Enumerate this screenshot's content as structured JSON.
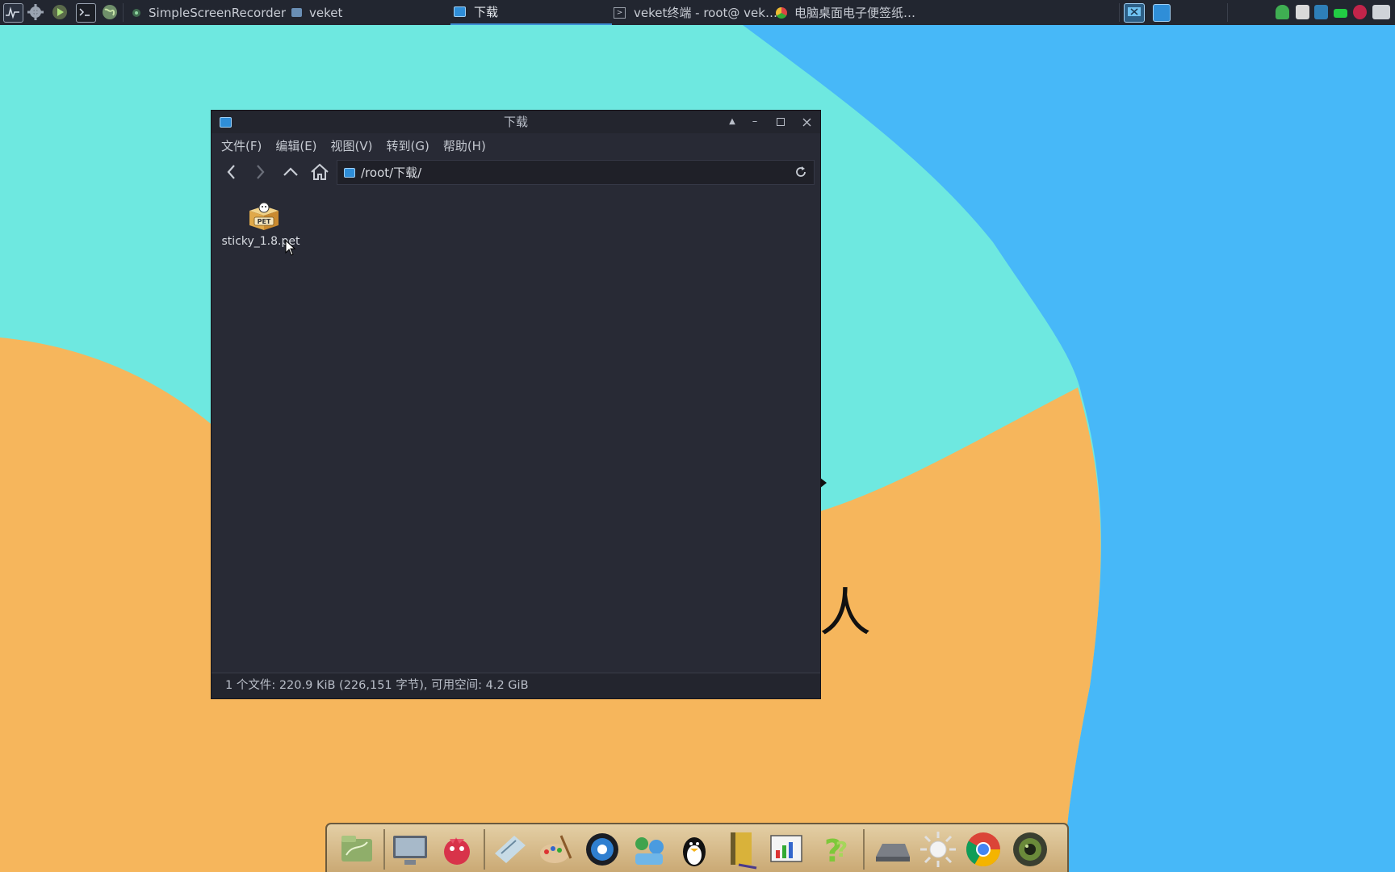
{
  "taskbar": {
    "launchers": [
      "system-monitor-icon",
      "settings-gear-icon",
      "run-icon",
      "terminal-icon",
      "globe-icon"
    ],
    "tasks": [
      {
        "label": "SimpleScreenRecorder",
        "icon": "screen-recorder-icon",
        "active": false
      },
      {
        "label": "veket",
        "icon": "folder-icon",
        "active": false
      },
      {
        "label": "下载",
        "icon": "file-manager-icon",
        "active": true
      },
      {
        "label": "veket终端 - root@ vek…",
        "icon": "terminal-icon",
        "active": false
      },
      {
        "label": "电脑桌面电子便签纸…",
        "icon": "chrome-icon",
        "active": false
      }
    ],
    "tray": [
      "monitor-icon",
      "file-manager-icon",
      "shield-icon",
      "clipboard-icon",
      "network-icon",
      "battery-icon",
      "record-icon",
      "keyboard-icon"
    ]
  },
  "window": {
    "title": "下载",
    "menus": [
      "文件(F)",
      "编辑(E)",
      "视图(V)",
      "转到(G)",
      "帮助(H)"
    ],
    "location": "/root/下载/",
    "files": [
      {
        "name": "sticky_1.8.pet",
        "icon_text": "PET",
        "icon": "pet-package-icon"
      }
    ],
    "status": "1 个文件: 220.9 KiB (226,151 字节), 可用空间: 4.2 GiB"
  },
  "desktop": {
    "fragment_text": "人"
  },
  "dock": {
    "apps": [
      "file-manager-app-icon",
      "display-settings-app-icon",
      "pet-manager-app-icon",
      "text-editor-app-icon",
      "paint-app-icon",
      "media-player-app-icon",
      "contacts-app-icon",
      "qq-penguin-app-icon",
      "notebook-app-icon",
      "spreadsheet-app-icon",
      "help-app-icon",
      "scanner-app-icon",
      "brightness-app-icon",
      "chrome-app-icon",
      "camera-app-icon"
    ]
  },
  "colors": {
    "wallpaper_cyan": "#6ee8e0",
    "wallpaper_blue": "#47b8f8",
    "wallpaper_orange": "#f6b65c",
    "window_bg": "#282a35",
    "panel_bg": "#222630",
    "accent": "#3d8fd6"
  }
}
